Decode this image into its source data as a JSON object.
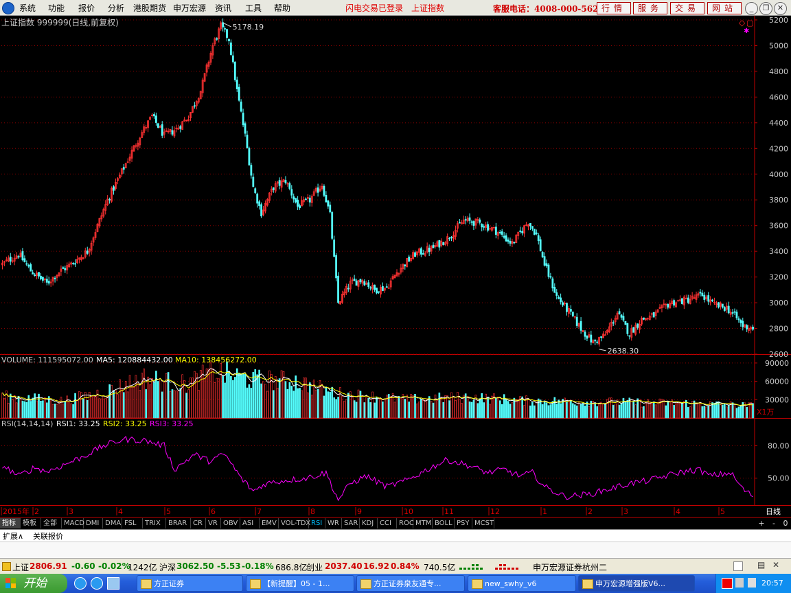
{
  "menubar": {
    "items": [
      "系统",
      "功能",
      "报价",
      "分析",
      "港股期货",
      "申万宏源",
      "资讯",
      "工具",
      "帮助"
    ],
    "status_login": "闪电交易已登录",
    "status_index": "上证指数",
    "hotline": "客服电话：4008-000-562",
    "buttons": [
      "行情",
      "服务",
      "交易",
      "网站"
    ]
  },
  "price_panel": {
    "title": "上证指数 999999(日线,前复权)",
    "high_label": "5178.19",
    "low_label": "2638.30"
  },
  "volume_panel": {
    "label_main": "VOLUME: 111595072.00",
    "label_ma5": "MA5: 120884432.00",
    "label_ma10": "MA10: 138456272.00",
    "unit": "X1万"
  },
  "rsi_panel": {
    "label_main": "RSI(14,14,14)",
    "label_rsi1": "RSI1: 33.25",
    "label_rsi2": "RSI2: 33.25",
    "label_rsi3": "RSI3: 33.25"
  },
  "period_label": "日线",
  "indicator_tabs": [
    "指标",
    "模板",
    "全部",
    "MACD",
    "DMI",
    "DMA",
    "FSL",
    "TRIX",
    "BRAR",
    "CR",
    "VR",
    "OBV",
    "ASI",
    "EMV",
    "VOL-TDX",
    "RSI",
    "WR",
    "SAR",
    "KDJ",
    "CCI",
    "ROC",
    "MTM",
    "BOLL",
    "PSY",
    "MCST"
  ],
  "active_indicator": "RSI",
  "ext_tabs": [
    "扩展∧",
    "关联报价"
  ],
  "statusbar": {
    "sh_label": "上证",
    "sh_value": "2806.91",
    "sh_change": "-0.60",
    "sh_pct": "-0.02%",
    "sh_amount": "1242亿",
    "hs_label": "沪深",
    "hs_value": "3062.50",
    "hs_change": "-5.53",
    "hs_pct": "-0.18%",
    "hs_amount": "686.8亿",
    "cy_label": "创业",
    "cy_value": "2037.40",
    "cy_change": "16.92",
    "cy_pct": "0.84%",
    "cy_amount": "740.5亿",
    "broker": "申万宏源证券杭州二"
  },
  "taskbar": {
    "start": "开始",
    "tasks": [
      "方正证券",
      "【新提醒】05 - 1...",
      "方正证券泉友通专...",
      "new_swhy_v6",
      "申万宏源增强版V6..."
    ],
    "clock": "20:57"
  },
  "colors": {
    "up": "#ff3232",
    "down": "#54ffff",
    "ma5": "#ffffff",
    "ma10": "#ffff00",
    "rsi": "#ff00ff",
    "axis": "#c00000"
  },
  "chart_data": [
    {
      "type": "candlestick",
      "title": "上证指数 999999(日线,前复权)",
      "x_month_labels": [
        "2015年",
        "2",
        "3",
        "4",
        "5",
        "6",
        "7",
        "8",
        "9",
        "10",
        "11",
        "12",
        "1",
        "2",
        "3",
        "4",
        "5"
      ],
      "ylim": [
        2600,
        5200
      ],
      "y_ticks": [
        2600,
        2800,
        3000,
        3200,
        3400,
        3600,
        3800,
        4000,
        4200,
        4400,
        4600,
        4800,
        5000,
        5200
      ],
      "annotations": [
        {
          "text": "5178.19",
          "y": 5178.19
        },
        {
          "text": "2638.30",
          "y": 2638.3
        }
      ],
      "close_path": [
        [
          0,
          3300
        ],
        [
          8,
          3380
        ],
        [
          14,
          3250
        ],
        [
          22,
          3150
        ],
        [
          28,
          3240
        ],
        [
          34,
          3300
        ],
        [
          42,
          3400
        ],
        [
          52,
          3800
        ],
        [
          60,
          4050
        ],
        [
          68,
          4300
        ],
        [
          74,
          4450
        ],
        [
          80,
          4300
        ],
        [
          86,
          4350
        ],
        [
          92,
          4450
        ],
        [
          98,
          4650
        ],
        [
          104,
          5000
        ],
        [
          108,
          5150
        ],
        [
          112,
          5050
        ],
        [
          116,
          4650
        ],
        [
          120,
          4300
        ],
        [
          124,
          3900
        ],
        [
          128,
          3700
        ],
        [
          134,
          3900
        ],
        [
          140,
          3950
        ],
        [
          146,
          3750
        ],
        [
          152,
          3800
        ],
        [
          158,
          3920
        ],
        [
          162,
          3680
        ],
        [
          166,
          3000
        ],
        [
          172,
          3150
        ],
        [
          178,
          3180
        ],
        [
          184,
          3100
        ],
        [
          190,
          3120
        ],
        [
          196,
          3260
        ],
        [
          204,
          3380
        ],
        [
          212,
          3420
        ],
        [
          220,
          3500
        ],
        [
          228,
          3640
        ],
        [
          236,
          3620
        ],
        [
          244,
          3560
        ],
        [
          252,
          3460
        ],
        [
          260,
          3630
        ],
        [
          264,
          3530
        ],
        [
          268,
          3300
        ],
        [
          274,
          3050
        ],
        [
          280,
          2930
        ],
        [
          286,
          2800
        ],
        [
          292,
          2690
        ],
        [
          298,
          2750
        ],
        [
          304,
          2920
        ],
        [
          310,
          2760
        ],
        [
          316,
          2870
        ],
        [
          322,
          2900
        ],
        [
          330,
          3000
        ],
        [
          338,
          3020
        ],
        [
          346,
          3060
        ],
        [
          352,
          2980
        ],
        [
          358,
          2960
        ],
        [
          362,
          2900
        ],
        [
          366,
          2820
        ],
        [
          371,
          2806.91
        ]
      ],
      "volume": {
        "unit": "X1万",
        "ylim": [
          0,
          100000
        ],
        "y_ticks": [
          30000,
          60000,
          90000
        ],
        "ma5": "120884432.00",
        "ma10": "138456272.00",
        "path": [
          [
            0,
            35000
          ],
          [
            30,
            28000
          ],
          [
            50,
            42000
          ],
          [
            70,
            65000
          ],
          [
            90,
            55000
          ],
          [
            105,
            75000
          ],
          [
            125,
            62000
          ],
          [
            145,
            60000
          ],
          [
            165,
            40000
          ],
          [
            200,
            30000
          ],
          [
            230,
            34000
          ],
          [
            260,
            28000
          ],
          [
            300,
            26000
          ],
          [
            340,
            24000
          ],
          [
            371,
            20000
          ]
        ]
      },
      "rsi": {
        "ylim": [
          25,
          100
        ],
        "y_ticks": [
          50,
          80
        ],
        "rsi1": "33.25",
        "path": [
          [
            0,
            62
          ],
          [
            8,
            52
          ],
          [
            16,
            60
          ],
          [
            22,
            56
          ],
          [
            30,
            62
          ],
          [
            40,
            70
          ],
          [
            50,
            80
          ],
          [
            60,
            86
          ],
          [
            70,
            85
          ],
          [
            80,
            80
          ],
          [
            85,
            58
          ],
          [
            95,
            72
          ],
          [
            102,
            66
          ],
          [
            110,
            72
          ],
          [
            118,
            50
          ],
          [
            124,
            38
          ],
          [
            130,
            45
          ],
          [
            140,
            48
          ],
          [
            150,
            50
          ],
          [
            160,
            55
          ],
          [
            166,
            30
          ],
          [
            172,
            45
          ],
          [
            180,
            52
          ],
          [
            190,
            42
          ],
          [
            200,
            48
          ],
          [
            212,
            60
          ],
          [
            220,
            67
          ],
          [
            230,
            62
          ],
          [
            240,
            55
          ],
          [
            248,
            58
          ],
          [
            256,
            52
          ],
          [
            262,
            55
          ],
          [
            268,
            42
          ],
          [
            278,
            33
          ],
          [
            290,
            35
          ],
          [
            300,
            40
          ],
          [
            310,
            45
          ],
          [
            320,
            48
          ],
          [
            334,
            55
          ],
          [
            344,
            58
          ],
          [
            350,
            52
          ],
          [
            360,
            55
          ],
          [
            366,
            40
          ],
          [
            371,
            33.25
          ]
        ]
      }
    }
  ]
}
